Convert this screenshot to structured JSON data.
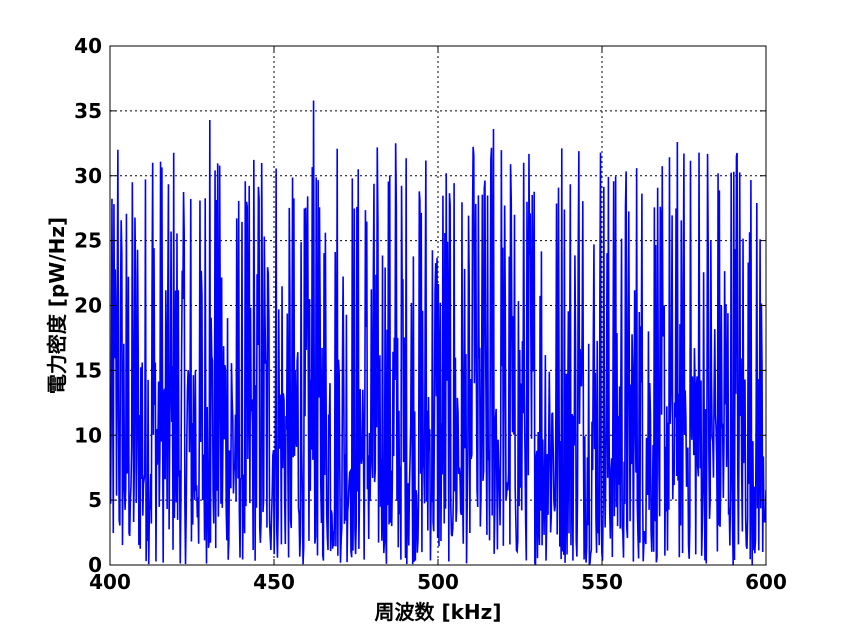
{
  "chart_data": {
    "type": "line",
    "title": "",
    "xlabel": "周波数 [kHz]",
    "ylabel": "電力密度 [pW/Hz]",
    "xlim": [
      400,
      600
    ],
    "ylim": [
      0,
      40
    ],
    "x_ticks": [
      "400",
      "450",
      "500",
      "550",
      "600"
    ],
    "y_ticks": [
      "0",
      "5",
      "10",
      "15",
      "20",
      "25",
      "30",
      "35",
      "40"
    ],
    "grid": true,
    "grid_style": "dotted",
    "series": [
      {
        "name": "",
        "color": "#0000ff",
        "x_start": 400,
        "x_end": 600,
        "sample_count": 1000,
        "mean": 13,
        "max": 35.8,
        "min": 0,
        "notable_peaks": [
          {
            "x": 402.5,
            "y": 32.0
          },
          {
            "x": 413.0,
            "y": 31.0
          },
          {
            "x": 430.5,
            "y": 34.3
          },
          {
            "x": 462.0,
            "y": 35.8
          },
          {
            "x": 487.0,
            "y": 32.5
          },
          {
            "x": 517.0,
            "y": 33.6
          },
          {
            "x": 543.0,
            "y": 31.9
          },
          {
            "x": 573.0,
            "y": 32.6
          },
          {
            "x": 591.0,
            "y": 31.5
          }
        ]
      }
    ]
  },
  "colors": {
    "line": "#0000ff",
    "axes": "#000000",
    "grid": "#000000",
    "background": "#ffffff"
  }
}
